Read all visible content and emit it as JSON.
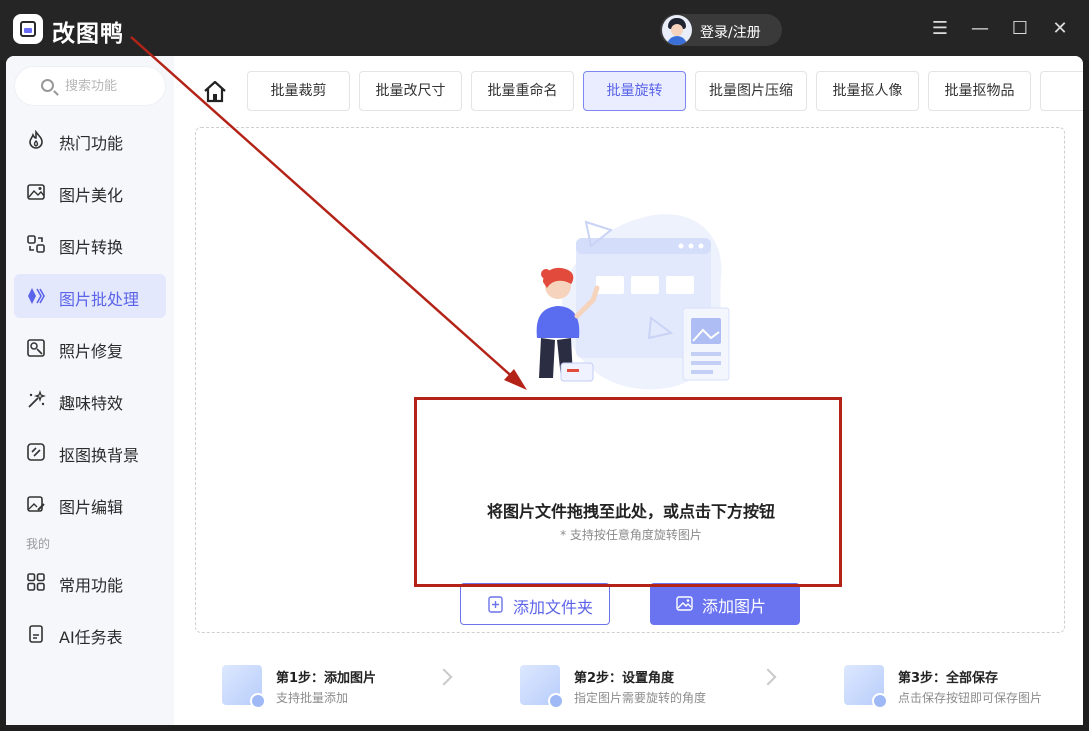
{
  "app": {
    "title": "改图鸭"
  },
  "titlebar": {
    "login_label": "登录/注册",
    "menu_icon": "☰",
    "minimize_icon": "—",
    "maximize_icon": "☐",
    "close_icon": "✕"
  },
  "sidebar": {
    "search_placeholder": "搜索功能",
    "items": [
      {
        "label": "热门功能",
        "icon": "flame-icon"
      },
      {
        "label": "图片美化",
        "icon": "image-beautify-icon"
      },
      {
        "label": "图片转换",
        "icon": "convert-icon"
      },
      {
        "label": "图片批处理",
        "icon": "batch-icon",
        "active": true
      },
      {
        "label": "照片修复",
        "icon": "photo-repair-icon"
      },
      {
        "label": "趣味特效",
        "icon": "magic-wand-icon"
      },
      {
        "label": "抠图换背景",
        "icon": "cutout-icon"
      },
      {
        "label": "图片编辑",
        "icon": "edit-image-icon"
      }
    ],
    "section_mine": "我的",
    "mine_items": [
      {
        "label": "常用功能",
        "icon": "grid-icon"
      },
      {
        "label": "AI任务表",
        "icon": "document-icon"
      }
    ]
  },
  "tabs": [
    "批量裁剪",
    "批量改尺寸",
    "批量重命名",
    "批量旋转",
    "批量图片压缩",
    "批量抠人像",
    "批量抠物品"
  ],
  "active_tab": "批量旋转",
  "dropzone": {
    "title": "将图片文件拖拽至此处，或点击下方按钮",
    "subtitle": "* 支持按任意角度旋转图片",
    "add_folder": "添加文件夹",
    "add_image": "添加图片"
  },
  "steps": [
    {
      "title": "第1步：添加图片",
      "desc": "支持批量添加"
    },
    {
      "title": "第2步：设置角度",
      "desc": "指定图片需要旋转的角度"
    },
    {
      "title": "第3步：全部保存",
      "desc": "点击保存按钮即可保存图片"
    }
  ],
  "colors": {
    "accent": "#6b74f0",
    "annotation": "#b42318"
  }
}
